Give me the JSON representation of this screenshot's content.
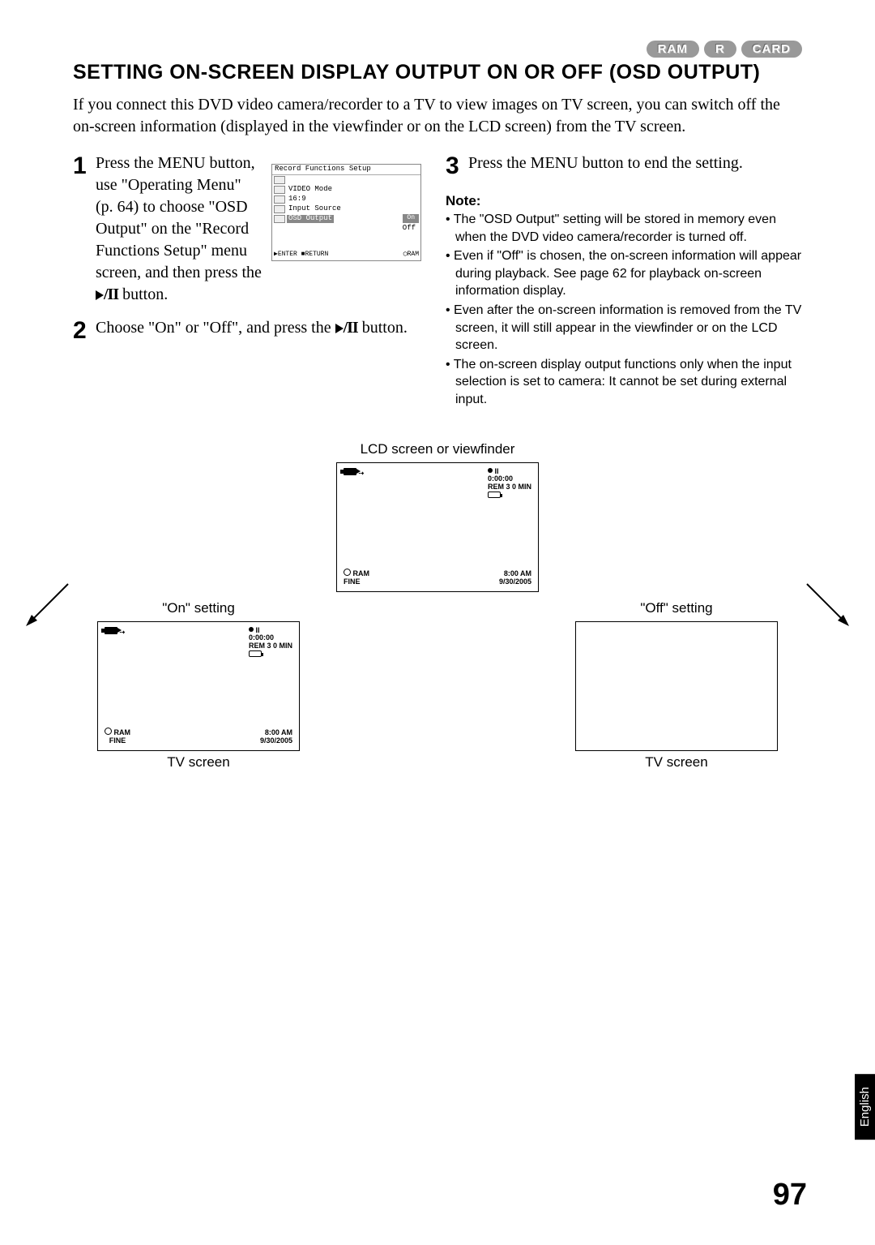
{
  "badges": {
    "ram": "RAM",
    "r": "R",
    "card": "CARD"
  },
  "title": "SETTING ON-SCREEN DISPLAY OUTPUT ON OR OFF (OSD OUTPUT)",
  "intro": "If you connect this DVD video camera/recorder to a TV to view images on TV screen, you can switch off the on-screen information (displayed in the viewfinder or on the LCD screen) from the TV screen.",
  "steps": {
    "s1": "Press the MENU button, use \"Operating Menu\" (p. 64) to choose \"OSD Output\" on the \"Record Functions Setup\" menu screen, and then press the ",
    "s1_tail": " button.",
    "s2a": "Choose \"On\" or \"Off\", and press the ",
    "s2b": " button.",
    "s3": "Press the MENU button to end the setting."
  },
  "menu": {
    "title": "Record Functions Setup",
    "items": [
      "VIDEO Mode",
      "16:9",
      "Input Source",
      "OSD Output"
    ],
    "opt_on": "On",
    "opt_off": "Off",
    "enter": "ENTER",
    "return": "RETURN",
    "ram": "RAM"
  },
  "note_heading": "Note:",
  "notes": [
    "The \"OSD Output\" setting will be stored in memory even when the DVD video camera/recorder is turned off.",
    "Even if \"Off\" is chosen, the on-screen information will appear during playback. See page 62 for playback on-screen information display.",
    "Even after the on-screen information is removed from the TV screen, it will still appear in the viewfinder or on the LCD screen.",
    "The on-screen display output functions only when the input selection is set to camera: It cannot be set during external input."
  ],
  "diagram": {
    "lcd_caption": "LCD screen or viewfinder",
    "on_label": "\"On\" setting",
    "off_label": "\"Off\" setting",
    "tv_caption": "TV screen",
    "osd": {
      "time": "0:00:00",
      "rem": "REM 3 0 MIN",
      "ram": "RAM",
      "fine": "FINE",
      "clock": "8:00 AM",
      "date": "9/30/2005",
      "pause": "II"
    }
  },
  "lang": "English",
  "page": "97"
}
